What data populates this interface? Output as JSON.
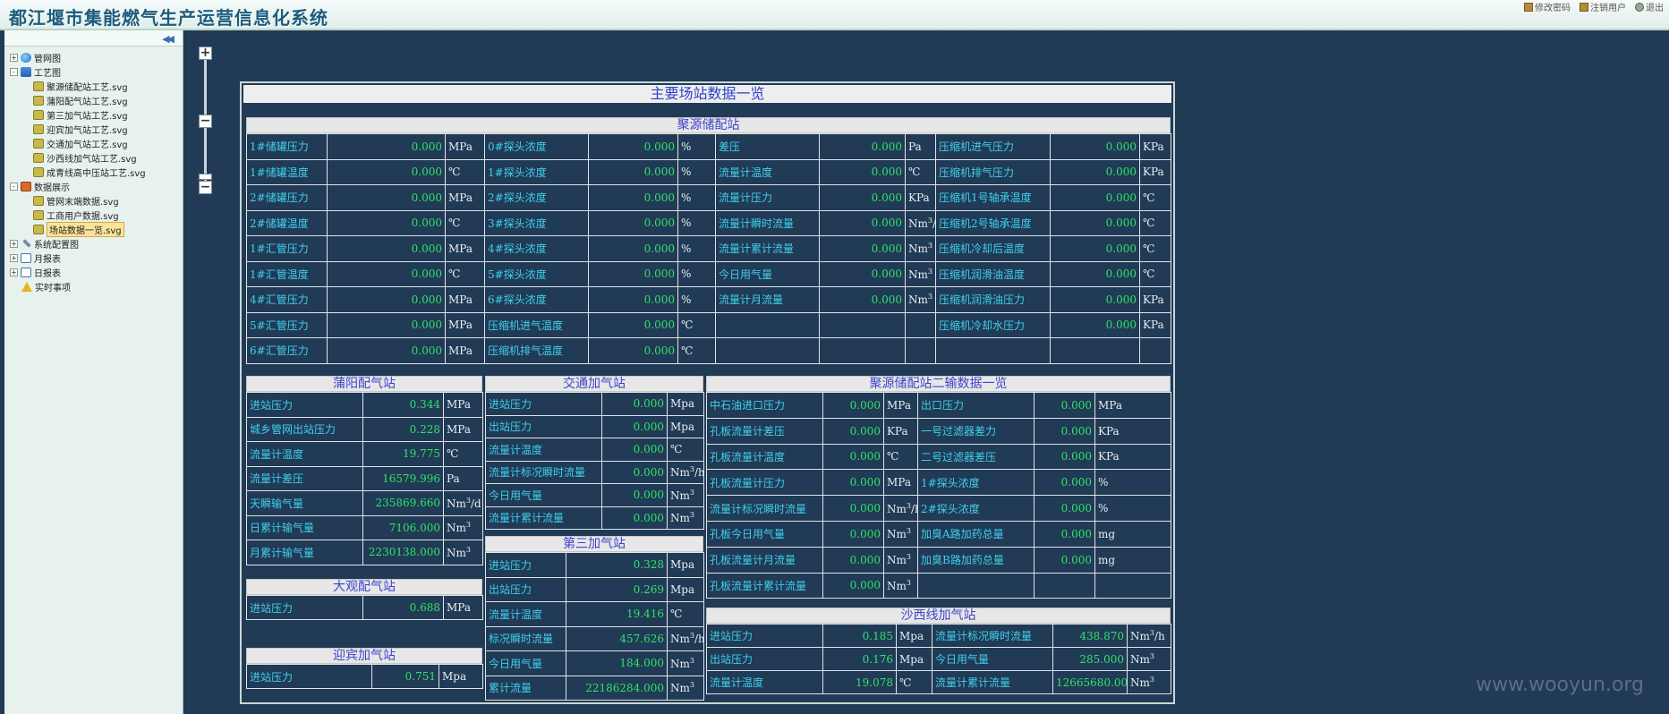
{
  "header": {
    "title": "都江堰市集能燃气生产运营信息化系统",
    "links": [
      "修改密码",
      "注销用户",
      "退出"
    ]
  },
  "sidebar": {
    "collapse": "◀◀",
    "tree": [
      {
        "depth": 0,
        "pm": "+",
        "icon": "globe",
        "label": "管网图"
      },
      {
        "depth": 0,
        "pm": "-",
        "icon": "net",
        "label": "工艺图"
      },
      {
        "depth": 2,
        "icon": "svg",
        "label": "聚源储配站工艺.svg"
      },
      {
        "depth": 2,
        "icon": "svg",
        "label": "蒲阳配气站工艺.svg"
      },
      {
        "depth": 2,
        "icon": "svg",
        "label": "第三加气站工艺.svg"
      },
      {
        "depth": 2,
        "icon": "svg",
        "label": "迎宾加气站工艺.svg"
      },
      {
        "depth": 2,
        "icon": "svg",
        "label": "交通加气站工艺.svg"
      },
      {
        "depth": 2,
        "icon": "svg",
        "label": "沙西线加气站工艺.svg"
      },
      {
        "depth": 2,
        "icon": "svg",
        "label": "成青线高中压站工艺.svg"
      },
      {
        "depth": 0,
        "pm": "-",
        "icon": "data",
        "label": "数据展示"
      },
      {
        "depth": 2,
        "icon": "svg",
        "label": "管网末端数据.svg"
      },
      {
        "depth": 2,
        "icon": "svg",
        "label": "工商用户数据.svg"
      },
      {
        "depth": 2,
        "icon": "svg",
        "label": "场站数据一览.svg",
        "selected": true
      },
      {
        "depth": 0,
        "pm": "+",
        "icon": "tool",
        "label": "系统配置图"
      },
      {
        "depth": 0,
        "pm": "+",
        "icon": "doc",
        "label": "月报表"
      },
      {
        "depth": 0,
        "pm": "+",
        "icon": "doc",
        "label": "日报表"
      },
      {
        "depth": 1,
        "icon": "warn",
        "label": "实时事项"
      }
    ]
  },
  "zoom": {
    "plus": "+",
    "minus": "−",
    "mid": "−"
  },
  "panel_title": "主要场站数据一览",
  "juyuan": {
    "title": "聚源储配站",
    "rows": [
      [
        "1#储罐压力",
        "0.000",
        "MPa",
        "0#探头浓度",
        "0.000",
        "%",
        "差压",
        "0.000",
        "Pa",
        "压缩机进气压力",
        "0.000",
        "KPa"
      ],
      [
        "1#储罐温度",
        "0.000",
        "℃",
        "1#探头浓度",
        "0.000",
        "%",
        "流量计温度",
        "0.000",
        "℃",
        "压缩机排气压力",
        "0.000",
        "KPa"
      ],
      [
        "2#储罐压力",
        "0.000",
        "MPa",
        "2#探头浓度",
        "0.000",
        "%",
        "流量计压力",
        "0.000",
        "KPa",
        "压缩机1号轴承温度",
        "0.000",
        "℃"
      ],
      [
        "2#储罐温度",
        "0.000",
        "℃",
        "3#探头浓度",
        "0.000",
        "%",
        "流量计瞬时流量",
        "0.000",
        "Nm³/h",
        "压缩机2号轴承温度",
        "0.000",
        "℃"
      ],
      [
        "1#汇管压力",
        "0.000",
        "MPa",
        "4#探头浓度",
        "0.000",
        "%",
        "流量计累计流量",
        "0.000",
        "Nm³",
        "压缩机冷却后温度",
        "0.000",
        "℃"
      ],
      [
        "1#汇管温度",
        "0.000",
        "℃",
        "5#探头浓度",
        "0.000",
        "%",
        "今日用气量",
        "0.000",
        "Nm³",
        "压缩机润滑油温度",
        "0.000",
        "℃"
      ],
      [
        "4#汇管压力",
        "0.000",
        "MPa",
        "6#探头浓度",
        "0.000",
        "%",
        "流量计月流量",
        "0.000",
        "Nm³",
        "压缩机润滑油压力",
        "0.000",
        "KPa"
      ],
      [
        "5#汇管压力",
        "0.000",
        "MPa",
        "压缩机进气温度",
        "0.000",
        "℃",
        "",
        "",
        "",
        "压缩机冷却水压力",
        "0.000",
        "KPa"
      ],
      [
        "6#汇管压力",
        "0.000",
        "MPa",
        "压缩机排气温度",
        "0.000",
        "℃",
        "",
        "",
        "",
        "",
        "",
        ""
      ]
    ]
  },
  "puyang": {
    "title": "蒲阳配气站",
    "rows": [
      [
        "进站压力",
        "0.344",
        "MPa"
      ],
      [
        "城乡管网出站压力",
        "0.228",
        "MPa"
      ],
      [
        "流量计温度",
        "19.775",
        "℃"
      ],
      [
        "流量计差压",
        "16579.996",
        "Pa"
      ],
      [
        "天瞬输气量",
        "235869.660",
        "Nm³/d"
      ],
      [
        "日累计输气量",
        "7106.000",
        "Nm³"
      ],
      [
        "月累计输气量",
        "2230138.000",
        "Nm³"
      ]
    ]
  },
  "daguan": {
    "title": "大观配气站",
    "rows": [
      [
        "进站压力",
        "0.688",
        "MPa"
      ]
    ]
  },
  "yingbin": {
    "title": "迎宾加气站",
    "rows": [
      [
        "进站压力",
        "0.751",
        "Mpa"
      ]
    ]
  },
  "jiaotong": {
    "title": "交通加气站",
    "rows": [
      [
        "进站压力",
        "0.000",
        "Mpa"
      ],
      [
        "出站压力",
        "0.000",
        "Mpa"
      ],
      [
        "流量计温度",
        "0.000",
        "℃"
      ],
      [
        "流量计标况瞬时流量",
        "0.000",
        "Nm³/h"
      ],
      [
        "今日用气量",
        "0.000",
        "Nm³"
      ],
      [
        "流量计累计流量",
        "0.000",
        "Nm³"
      ]
    ]
  },
  "disan": {
    "title": "第三加气站",
    "rows": [
      [
        "进站压力",
        "0.328",
        "Mpa"
      ],
      [
        "出站压力",
        "0.269",
        "Mpa"
      ],
      [
        "流量计温度",
        "19.416",
        "℃"
      ],
      [
        "标况瞬时流量",
        "457.626",
        "Nm³/h"
      ],
      [
        "今日用气量",
        "184.000",
        "Nm³"
      ],
      [
        "累计流量",
        "22186284.000",
        "Nm³"
      ]
    ]
  },
  "juyuan2": {
    "title": "聚源储配站二输数据一览",
    "rows": [
      [
        "中石油进口压力",
        "0.000",
        "MPa",
        "出口压力",
        "0.000",
        "MPa"
      ],
      [
        "孔板流量计差压",
        "0.000",
        "KPa",
        "一号过滤器差力",
        "0.000",
        "KPa"
      ],
      [
        "孔板流量计温度",
        "0.000",
        "℃",
        "二号过滤器差压",
        "0.000",
        "KPa"
      ],
      [
        "孔板流量计压力",
        "0.000",
        "MPa",
        "1#探头浓度",
        "0.000",
        "%"
      ],
      [
        "流量计标况瞬时流量",
        "0.000",
        "Nm³/h",
        "2#探头浓度",
        "0.000",
        "%"
      ],
      [
        "孔板今日用气量",
        "0.000",
        "Nm³",
        "加臭A路加药总量",
        "0.000",
        "mg"
      ],
      [
        "孔板流量计月流量",
        "0.000",
        "Nm³",
        "加臭B路加药总量",
        "0.000",
        "mg"
      ],
      [
        "孔板流量计累计流量",
        "0.000",
        "Nm³",
        "",
        "",
        ""
      ]
    ]
  },
  "shaxi": {
    "title": "沙西线加气站",
    "rows": [
      [
        "进站压力",
        "0.185",
        "Mpa",
        "流量计标况瞬时流量",
        "438.870",
        "Nm³/h"
      ],
      [
        "出站压力",
        "0.176",
        "Mpa",
        "今日用气量",
        "285.000",
        "Nm³"
      ],
      [
        "流量计温度",
        "19.078",
        "℃",
        "流量计累计流量",
        "12665680.000",
        "Nm³"
      ]
    ]
  },
  "watermark": "www.wooyun.org"
}
